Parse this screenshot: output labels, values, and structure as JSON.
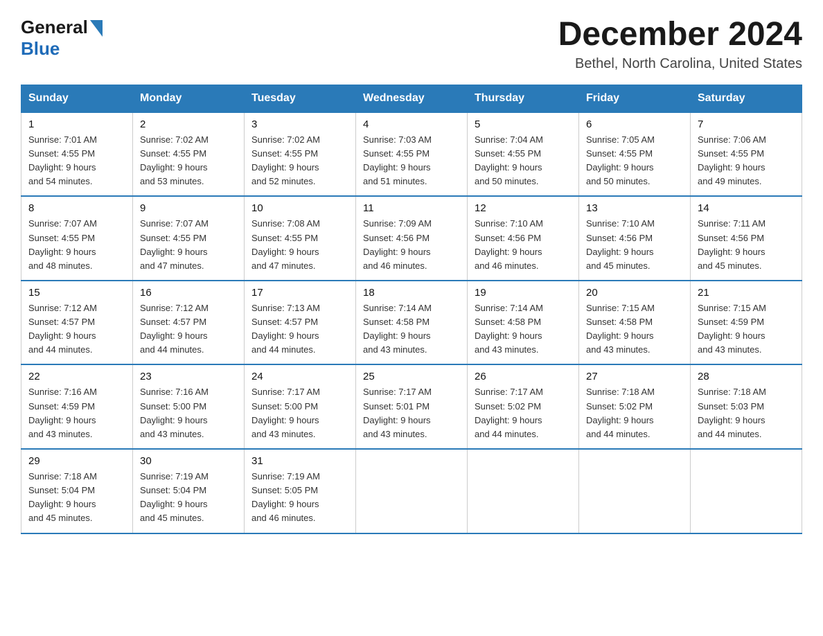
{
  "header": {
    "logo_general": "General",
    "logo_blue": "Blue",
    "title": "December 2024",
    "subtitle": "Bethel, North Carolina, United States"
  },
  "weekdays": [
    "Sunday",
    "Monday",
    "Tuesday",
    "Wednesday",
    "Thursday",
    "Friday",
    "Saturday"
  ],
  "weeks": [
    [
      {
        "day": "1",
        "sunrise": "7:01 AM",
        "sunset": "4:55 PM",
        "daylight": "9 hours and 54 minutes."
      },
      {
        "day": "2",
        "sunrise": "7:02 AM",
        "sunset": "4:55 PM",
        "daylight": "9 hours and 53 minutes."
      },
      {
        "day": "3",
        "sunrise": "7:02 AM",
        "sunset": "4:55 PM",
        "daylight": "9 hours and 52 minutes."
      },
      {
        "day": "4",
        "sunrise": "7:03 AM",
        "sunset": "4:55 PM",
        "daylight": "9 hours and 51 minutes."
      },
      {
        "day": "5",
        "sunrise": "7:04 AM",
        "sunset": "4:55 PM",
        "daylight": "9 hours and 50 minutes."
      },
      {
        "day": "6",
        "sunrise": "7:05 AM",
        "sunset": "4:55 PM",
        "daylight": "9 hours and 50 minutes."
      },
      {
        "day": "7",
        "sunrise": "7:06 AM",
        "sunset": "4:55 PM",
        "daylight": "9 hours and 49 minutes."
      }
    ],
    [
      {
        "day": "8",
        "sunrise": "7:07 AM",
        "sunset": "4:55 PM",
        "daylight": "9 hours and 48 minutes."
      },
      {
        "day": "9",
        "sunrise": "7:07 AM",
        "sunset": "4:55 PM",
        "daylight": "9 hours and 47 minutes."
      },
      {
        "day": "10",
        "sunrise": "7:08 AM",
        "sunset": "4:55 PM",
        "daylight": "9 hours and 47 minutes."
      },
      {
        "day": "11",
        "sunrise": "7:09 AM",
        "sunset": "4:56 PM",
        "daylight": "9 hours and 46 minutes."
      },
      {
        "day": "12",
        "sunrise": "7:10 AM",
        "sunset": "4:56 PM",
        "daylight": "9 hours and 46 minutes."
      },
      {
        "day": "13",
        "sunrise": "7:10 AM",
        "sunset": "4:56 PM",
        "daylight": "9 hours and 45 minutes."
      },
      {
        "day": "14",
        "sunrise": "7:11 AM",
        "sunset": "4:56 PM",
        "daylight": "9 hours and 45 minutes."
      }
    ],
    [
      {
        "day": "15",
        "sunrise": "7:12 AM",
        "sunset": "4:57 PM",
        "daylight": "9 hours and 44 minutes."
      },
      {
        "day": "16",
        "sunrise": "7:12 AM",
        "sunset": "4:57 PM",
        "daylight": "9 hours and 44 minutes."
      },
      {
        "day": "17",
        "sunrise": "7:13 AM",
        "sunset": "4:57 PM",
        "daylight": "9 hours and 44 minutes."
      },
      {
        "day": "18",
        "sunrise": "7:14 AM",
        "sunset": "4:58 PM",
        "daylight": "9 hours and 43 minutes."
      },
      {
        "day": "19",
        "sunrise": "7:14 AM",
        "sunset": "4:58 PM",
        "daylight": "9 hours and 43 minutes."
      },
      {
        "day": "20",
        "sunrise": "7:15 AM",
        "sunset": "4:58 PM",
        "daylight": "9 hours and 43 minutes."
      },
      {
        "day": "21",
        "sunrise": "7:15 AM",
        "sunset": "4:59 PM",
        "daylight": "9 hours and 43 minutes."
      }
    ],
    [
      {
        "day": "22",
        "sunrise": "7:16 AM",
        "sunset": "4:59 PM",
        "daylight": "9 hours and 43 minutes."
      },
      {
        "day": "23",
        "sunrise": "7:16 AM",
        "sunset": "5:00 PM",
        "daylight": "9 hours and 43 minutes."
      },
      {
        "day": "24",
        "sunrise": "7:17 AM",
        "sunset": "5:00 PM",
        "daylight": "9 hours and 43 minutes."
      },
      {
        "day": "25",
        "sunrise": "7:17 AM",
        "sunset": "5:01 PM",
        "daylight": "9 hours and 43 minutes."
      },
      {
        "day": "26",
        "sunrise": "7:17 AM",
        "sunset": "5:02 PM",
        "daylight": "9 hours and 44 minutes."
      },
      {
        "day": "27",
        "sunrise": "7:18 AM",
        "sunset": "5:02 PM",
        "daylight": "9 hours and 44 minutes."
      },
      {
        "day": "28",
        "sunrise": "7:18 AM",
        "sunset": "5:03 PM",
        "daylight": "9 hours and 44 minutes."
      }
    ],
    [
      {
        "day": "29",
        "sunrise": "7:18 AM",
        "sunset": "5:04 PM",
        "daylight": "9 hours and 45 minutes."
      },
      {
        "day": "30",
        "sunrise": "7:19 AM",
        "sunset": "5:04 PM",
        "daylight": "9 hours and 45 minutes."
      },
      {
        "day": "31",
        "sunrise": "7:19 AM",
        "sunset": "5:05 PM",
        "daylight": "9 hours and 46 minutes."
      },
      null,
      null,
      null,
      null
    ]
  ],
  "labels": {
    "sunrise": "Sunrise:",
    "sunset": "Sunset:",
    "daylight": "Daylight: 9 hours"
  }
}
